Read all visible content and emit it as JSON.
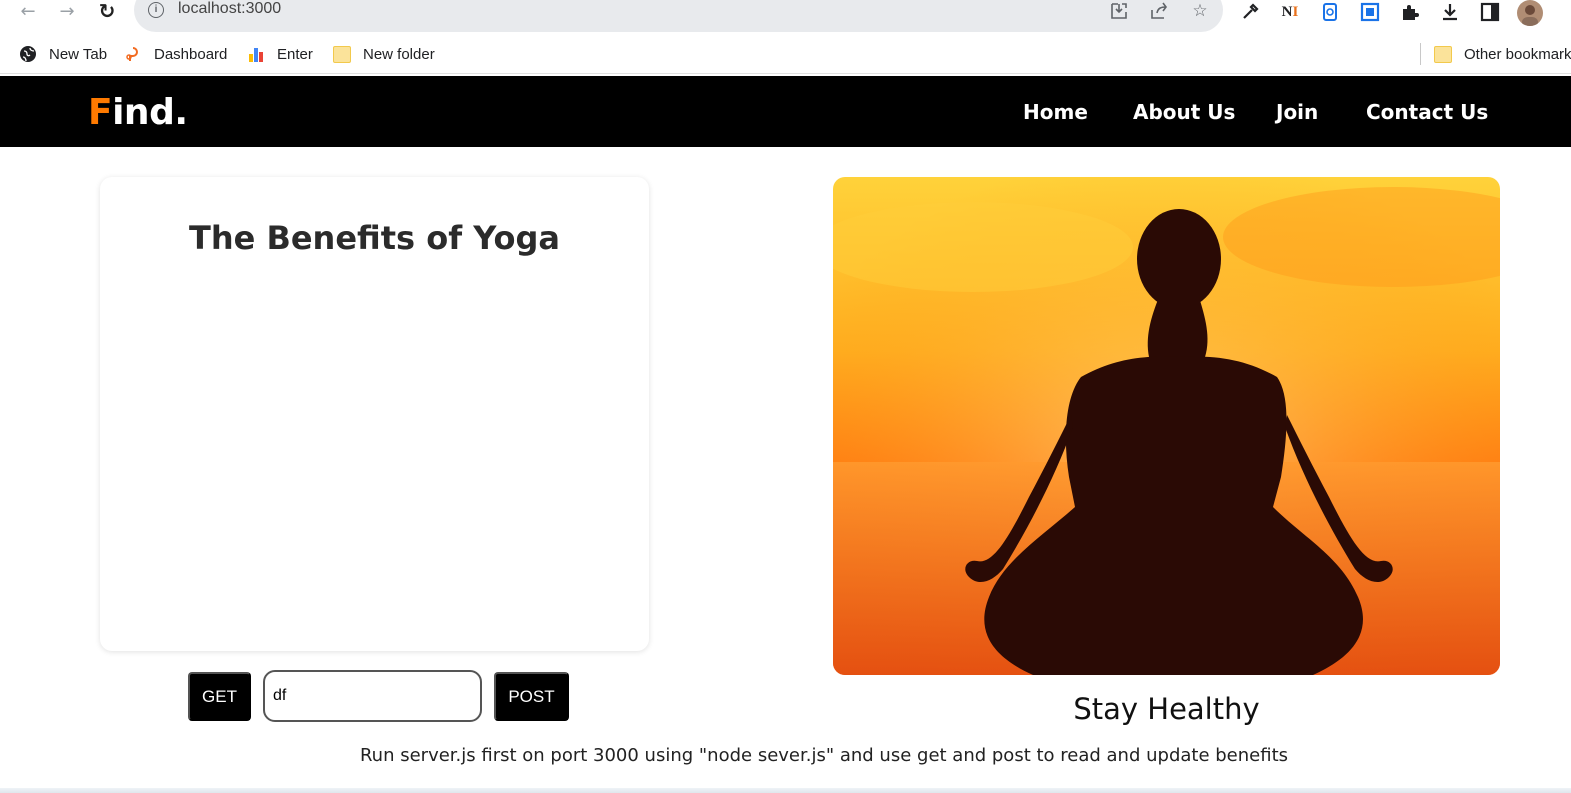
{
  "browser": {
    "url": "localhost:3000",
    "bookmarks": [
      {
        "label": "New Tab",
        "icon": "globe-icon"
      },
      {
        "label": "Dashboard",
        "icon": "dashboard-logo-icon"
      },
      {
        "label": "Enter",
        "icon": "bar-chart-icon"
      },
      {
        "label": "New folder",
        "icon": "folder-icon"
      }
    ],
    "other_bookmarks": "Other bookmarks",
    "colors": {
      "omnibox_bg": "#e8eaed"
    }
  },
  "site": {
    "logo_accent": "F",
    "logo_rest": "ind.",
    "nav": [
      "Home",
      "About Us",
      "Join",
      "Contact Us"
    ],
    "colors": {
      "nav_bg": "#000000",
      "accent": "#ff7a00"
    }
  },
  "main": {
    "card_title": "The Benefits of Yoga",
    "get_label": "GET",
    "input_value": "df",
    "post_label": "POST",
    "caption": "Stay Healthy",
    "footer_note": "Run server.js first on port 3000 using \"node sever.js\" and use get and post to read and update benefits"
  }
}
